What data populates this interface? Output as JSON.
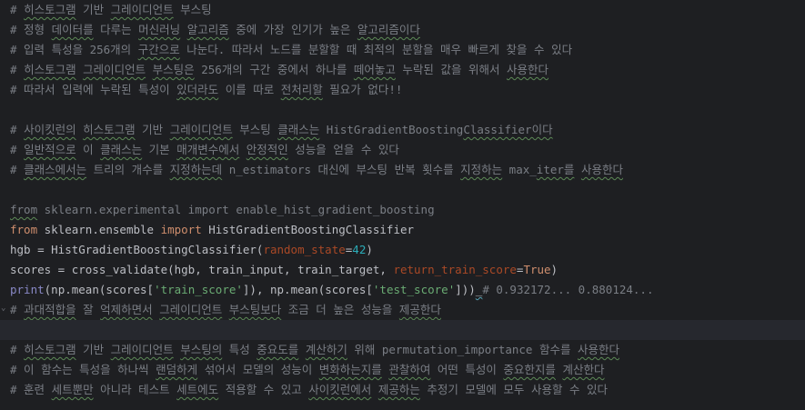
{
  "lines": [
    {
      "segments": [
        {
          "t": "# ",
          "c": "c"
        },
        {
          "t": "히스토그램",
          "c": "c sq"
        },
        {
          "t": " 기반 ",
          "c": "c"
        },
        {
          "t": "그레이디언트",
          "c": "c sq"
        },
        {
          "t": " 부스팅",
          "c": "c"
        }
      ]
    },
    {
      "segments": [
        {
          "t": "# 정형 ",
          "c": "c"
        },
        {
          "t": "데이터를",
          "c": "c sq"
        },
        {
          "t": " 다루는 ",
          "c": "c"
        },
        {
          "t": "머신러닝",
          "c": "c sq"
        },
        {
          "t": " ",
          "c": "c"
        },
        {
          "t": "알고리즘",
          "c": "c sq"
        },
        {
          "t": " 중에 가장 인기가 높은 ",
          "c": "c"
        },
        {
          "t": "알고리즘이다",
          "c": "c sq"
        }
      ]
    },
    {
      "segments": [
        {
          "t": "# 입력 특성을 256개의 ",
          "c": "c"
        },
        {
          "t": "구간으로",
          "c": "c sq"
        },
        {
          "t": " 나눈다. 따라서 노드를 분할할 때 최적의 분할을 매우 빠르게 찾을 수 있다",
          "c": "c"
        }
      ]
    },
    {
      "segments": [
        {
          "t": "# ",
          "c": "c"
        },
        {
          "t": "히스토그램",
          "c": "c sq"
        },
        {
          "t": " ",
          "c": "c"
        },
        {
          "t": "그레이디언트",
          "c": "c sq"
        },
        {
          "t": " ",
          "c": "c"
        },
        {
          "t": "부스팅은",
          "c": "c sq"
        },
        {
          "t": " 256개의 구간 중에서 하나를 ",
          "c": "c"
        },
        {
          "t": "떼어놓고",
          "c": "c sq"
        },
        {
          "t": " 누락된 값을 위해서 ",
          "c": "c"
        },
        {
          "t": "사용한다",
          "c": "c sq"
        }
      ]
    },
    {
      "segments": [
        {
          "t": "# 따라서 입력에 누락된 특성이 ",
          "c": "c"
        },
        {
          "t": "있더라도",
          "c": "c sq"
        },
        {
          "t": " 이를 따로 ",
          "c": "c"
        },
        {
          "t": "전처리할",
          "c": "c sq"
        },
        {
          "t": " 필요가 없다!!",
          "c": "c"
        }
      ]
    },
    {
      "segments": []
    },
    {
      "segments": [
        {
          "t": "# ",
          "c": "c"
        },
        {
          "t": "사이킷런의",
          "c": "c sq"
        },
        {
          "t": " ",
          "c": "c"
        },
        {
          "t": "히스토그램",
          "c": "c sq"
        },
        {
          "t": " 기반 ",
          "c": "c"
        },
        {
          "t": "그레이디언트",
          "c": "c sq"
        },
        {
          "t": " 부스팅 ",
          "c": "c"
        },
        {
          "t": "클래스는",
          "c": "c sq"
        },
        {
          "t": " HistGradientBoosting",
          "c": "c"
        },
        {
          "t": "Classifier이다",
          "c": "c sq"
        }
      ]
    },
    {
      "segments": [
        {
          "t": "# ",
          "c": "c"
        },
        {
          "t": "일반적으로",
          "c": "c sq"
        },
        {
          "t": " 이 ",
          "c": "c"
        },
        {
          "t": "클래스는",
          "c": "c sq"
        },
        {
          "t": " 기본 ",
          "c": "c"
        },
        {
          "t": "매개변수에서",
          "c": "c sq"
        },
        {
          "t": " ",
          "c": "c"
        },
        {
          "t": "안정적인",
          "c": "c sq"
        },
        {
          "t": " 성능을 얻을 수 있다",
          "c": "c"
        }
      ]
    },
    {
      "segments": [
        {
          "t": "# ",
          "c": "c"
        },
        {
          "t": "클래스에서는",
          "c": "c sq"
        },
        {
          "t": " 트리의 개수를 ",
          "c": "c"
        },
        {
          "t": "지정하는데",
          "c": "c sq"
        },
        {
          "t": " n_estimators 대신에 부스팅 반복 횟수를 ",
          "c": "c"
        },
        {
          "t": "지정하는",
          "c": "c sq"
        },
        {
          "t": " max_",
          "c": "c"
        },
        {
          "t": "iter를",
          "c": "c sq"
        },
        {
          "t": " ",
          "c": "c"
        },
        {
          "t": "사용한다",
          "c": "c sq"
        }
      ]
    },
    {
      "segments": []
    },
    {
      "segments": [
        {
          "t": "from",
          "c": "c sq"
        },
        {
          "t": " sklearn.experimental import enable_hist_gradient_boosting",
          "c": "c"
        }
      ]
    },
    {
      "segments": [
        {
          "t": "from",
          "c": "kw"
        },
        {
          "t": " sklearn.ensemble ",
          "c": ""
        },
        {
          "t": "import",
          "c": "kw"
        },
        {
          "t": " HistGradientBoostingClassifier",
          "c": ""
        }
      ]
    },
    {
      "segments": [
        {
          "t": "hgb = HistGradientBoostingClassifier(",
          "c": ""
        },
        {
          "t": "random_state",
          "c": "pn"
        },
        {
          "t": "=",
          "c": ""
        },
        {
          "t": "42",
          "c": "nm"
        },
        {
          "t": ")",
          "c": ""
        }
      ]
    },
    {
      "segments": [
        {
          "t": "scores = cross_validate(hgb, train_input, train_target, ",
          "c": ""
        },
        {
          "t": "return_train_score",
          "c": "pn"
        },
        {
          "t": "=",
          "c": ""
        },
        {
          "t": "True",
          "c": "kw"
        },
        {
          "t": ")",
          "c": ""
        }
      ]
    },
    {
      "segments": [
        {
          "t": "print",
          "c": "bi"
        },
        {
          "t": "(np.mean(scores[",
          "c": ""
        },
        {
          "t": "'train_score'",
          "c": "st"
        },
        {
          "t": "]), np.mean(scores[",
          "c": ""
        },
        {
          "t": "'test_score'",
          "c": "st"
        },
        {
          "t": "]))",
          "c": ""
        },
        {
          "t": "_",
          "c": "sqb"
        },
        {
          "t": "# 0.932172... 0.880124...",
          "c": "c"
        }
      ]
    },
    {
      "segments": [
        {
          "t": "# ",
          "c": "c"
        },
        {
          "t": "과대적합을",
          "c": "c sq"
        },
        {
          "t": " 잘 ",
          "c": "c"
        },
        {
          "t": "억제하면서",
          "c": "c sq"
        },
        {
          "t": " ",
          "c": "c"
        },
        {
          "t": "그레이디언트",
          "c": "c sq"
        },
        {
          "t": " ",
          "c": "c"
        },
        {
          "t": "부스팅보다",
          "c": "c sq"
        },
        {
          "t": " 조금 더 높은 성능을 ",
          "c": "c"
        },
        {
          "t": "제공한다",
          "c": "c sq"
        }
      ]
    },
    {
      "segments": []
    },
    {
      "segments": [
        {
          "t": "# ",
          "c": "c"
        },
        {
          "t": "히스토그램",
          "c": "c sq"
        },
        {
          "t": " 기반 ",
          "c": "c"
        },
        {
          "t": "그레이디언트",
          "c": "c sq"
        },
        {
          "t": " ",
          "c": "c"
        },
        {
          "t": "부스팅의",
          "c": "c sq"
        },
        {
          "t": " 특성 ",
          "c": "c"
        },
        {
          "t": "중요도를",
          "c": "c sq"
        },
        {
          "t": " ",
          "c": "c"
        },
        {
          "t": "계산하기",
          "c": "c sq"
        },
        {
          "t": " 위해 permutation_importance 함수를 ",
          "c": "c"
        },
        {
          "t": "사용한다",
          "c": "c sq"
        }
      ]
    },
    {
      "segments": [
        {
          "t": "# 이 함수는 특성을 하나씩 ",
          "c": "c"
        },
        {
          "t": "랜덤하게",
          "c": "c sq"
        },
        {
          "t": " 섞어서 모델의 성능이 ",
          "c": "c"
        },
        {
          "t": "변화하는지를",
          "c": "c sq"
        },
        {
          "t": " ",
          "c": "c"
        },
        {
          "t": "관찰하여",
          "c": "c sq"
        },
        {
          "t": " 어떤 특성이 ",
          "c": "c"
        },
        {
          "t": "중요한지를",
          "c": "c sq"
        },
        {
          "t": " ",
          "c": "c"
        },
        {
          "t": "계산한다",
          "c": "c sq"
        }
      ]
    },
    {
      "segments": [
        {
          "t": "# 훈련 ",
          "c": "c"
        },
        {
          "t": "세트뿐만",
          "c": "c sq"
        },
        {
          "t": " 아니라 테스트 ",
          "c": "c"
        },
        {
          "t": "세트에도",
          "c": "c sq"
        },
        {
          "t": " 적용할 수 있고 ",
          "c": "c"
        },
        {
          "t": "사이킷런에서",
          "c": "c sq"
        },
        {
          "t": " ",
          "c": "c"
        },
        {
          "t": "제공하는",
          "c": "c sq"
        },
        {
          "t": " 추정기 모델에 모두 사용할 수 있다",
          "c": "c"
        }
      ]
    }
  ],
  "current_line_index": 16,
  "colors": {
    "background": "#1e1f22",
    "comment": "#7a7e85",
    "keyword": "#cf8e6d",
    "string": "#6aab73",
    "number": "#2aacb8",
    "param": "#aa4926",
    "builtin": "#8888c6",
    "text": "#bcbec4",
    "current_line": "#26282e"
  },
  "icons": {
    "fold_marker": "chevron-down-icon"
  }
}
